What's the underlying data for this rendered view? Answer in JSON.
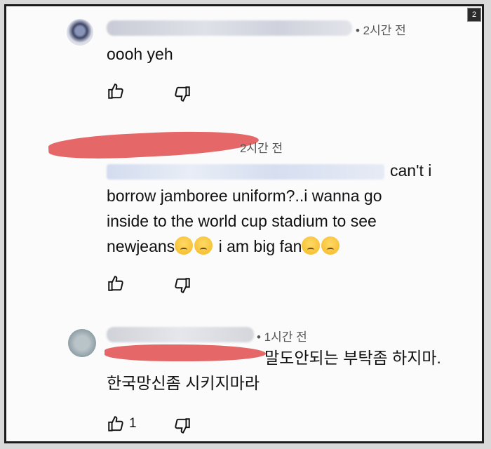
{
  "page_badge": "2",
  "comments": [
    {
      "time": "• 2시간 전",
      "text": "oooh yeh",
      "like_count": ""
    },
    {
      "time": "2시간 전",
      "line1": "can't i",
      "line2": "borrow jamboree uniform?..i wanna go",
      "line3": "inside to the world cup stadium to see",
      "line4a": "newjeans",
      "line4b": " i am big fan",
      "like_count": ""
    },
    {
      "time": "• 1시간 전",
      "line1": "말도안되는 부탁좀 하지마.",
      "line2": "한국망신좀 시키지마라",
      "like_count": "1"
    }
  ],
  "icons": {
    "like": "thumbs-up-icon",
    "dislike": "thumbs-down-icon",
    "emoji": "crying-face-emoji"
  }
}
